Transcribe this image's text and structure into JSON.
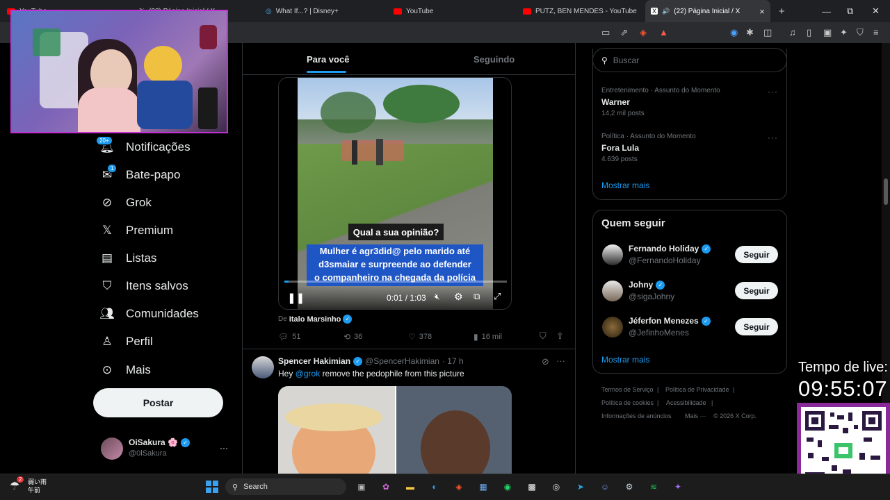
{
  "browser": {
    "tabs": [
      {
        "label": "YouTube"
      },
      {
        "label": "(22) Página Inicial / X"
      },
      {
        "label": "What If...? | Disney+"
      },
      {
        "label": "YouTube"
      },
      {
        "label": "PUTZ, BEN MENDES - YouTube"
      },
      {
        "label": "(22) Página Inicial / X",
        "active": true
      }
    ],
    "new_tab": "+",
    "minimize": "—",
    "maximize": "⧉",
    "close": "✕"
  },
  "nav": {
    "items": [
      {
        "label": "Notificações",
        "badge": "20+"
      },
      {
        "label": "Bate-papo",
        "badge": "1"
      },
      {
        "label": "Grok"
      },
      {
        "label": "Premium"
      },
      {
        "label": "Listas"
      },
      {
        "label": "Itens salvos"
      },
      {
        "label": "Comunidades"
      },
      {
        "label": "Perfil"
      },
      {
        "label": "Mais"
      }
    ],
    "post_button": "Postar",
    "account": {
      "name": "OiSakura 🌸",
      "handle": "@0lSakura",
      "more": "···"
    }
  },
  "feed": {
    "tabs": [
      "Para você",
      "Seguindo"
    ],
    "post1": {
      "video_question": "Qual a sua opinião?",
      "video_caption": [
        "Mulher é agr3did@ pelo marido até",
        "d3smaiar e surpreende ao defender",
        "o companheiro na chegada da polícia"
      ],
      "time": "0:01 / 1:03",
      "progress": 0.02,
      "source_prefix": "De",
      "source_name": "Italo Marsinho",
      "replies": "51",
      "reposts": "36",
      "likes": "378",
      "views": "16 mil"
    },
    "post2": {
      "name": "Spencer Hakimian",
      "handle": "@SpencerHakimian",
      "time": "· 17 h",
      "mention": "@grok",
      "text_before": "Hey",
      "text_after": "remove the pedophile from this picture"
    }
  },
  "sidebar": {
    "search_placeholder": "Buscar",
    "trends": [
      {
        "meta": "Entretenimento · Assunto do Momento",
        "name": "Warner",
        "count": "14,2 mil posts"
      },
      {
        "meta": "Política · Assunto do Momento",
        "name": "Fora Lula",
        "count": "4.639 posts"
      }
    ],
    "show_more": "Mostrar mais",
    "who_to_follow": {
      "title": "Quem seguir",
      "users": [
        {
          "name": "Fernando Holiday",
          "handle": "@FernandoHoliday"
        },
        {
          "name": "Johny",
          "handle": "@sigaJohny"
        },
        {
          "name": "Jéferfon Menezes",
          "handle": "@JefinhoMenes"
        }
      ],
      "follow_label": "Seguir",
      "show_more": "Mostrar mais"
    },
    "footer": {
      "line1": [
        "Termos de Serviço",
        "|",
        "Política de Privacidade",
        "|"
      ],
      "line2": [
        "Política de cookies",
        "|",
        "Acessibilidade",
        "|"
      ],
      "line3": [
        "Informações de anúncios",
        "Mais ···",
        "© 2026 X Corp."
      ]
    }
  },
  "overlay": {
    "live_label": "Tempo de live:",
    "live_time": "09:55:07"
  },
  "taskbar": {
    "weather_line1": "弱い雨",
    "weather_line2": "午前",
    "weather_badge": "2",
    "search_label": "Search"
  }
}
